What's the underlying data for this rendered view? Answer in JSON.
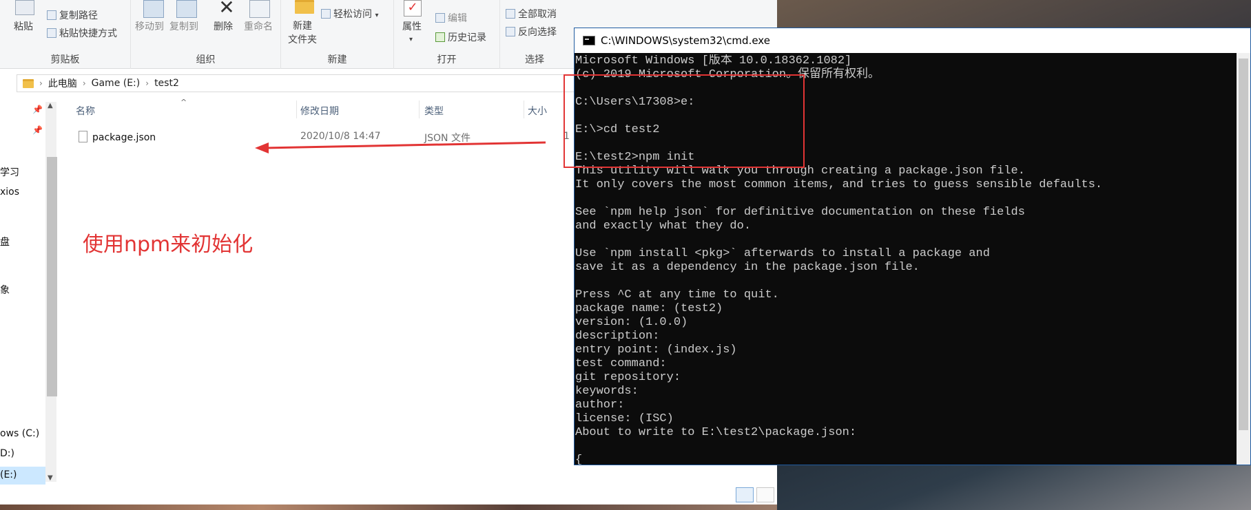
{
  "ribbon": {
    "clipboard": {
      "paste_label": "粘贴",
      "copy_path": "复制路径",
      "paste_shortcut": "粘贴快捷方式",
      "group_label": "剪贴板"
    },
    "organize": {
      "move_to": "移动到",
      "copy_to": "复制到",
      "delete": "删除",
      "rename": "重命名",
      "group_label": "组织"
    },
    "new": {
      "new_folder_line1": "新建",
      "new_folder_line2": "文件夹",
      "easy_access": "轻松访问",
      "group_label": "新建"
    },
    "open": {
      "properties": "属性",
      "edit": "编辑",
      "history": "历史记录",
      "group_label": "打开"
    },
    "select": {
      "select_none": "全部取消",
      "invert": "反向选择",
      "group_label": "选择"
    }
  },
  "address": {
    "crumbs": [
      "此电脑",
      "Game (E:)",
      "test2"
    ]
  },
  "nav": {
    "items": [
      "学习",
      "xios",
      "盘",
      "象",
      "ows (C:)",
      "D:)",
      "(E:)"
    ]
  },
  "filelist": {
    "columns": [
      "名称",
      "修改日期",
      "类型",
      "大小"
    ],
    "rows": [
      {
        "name": "package.json",
        "modified": "2020/10/8 14:47",
        "type": "JSON 文件",
        "size": "1"
      }
    ]
  },
  "annotation": {
    "text": "使用npm来初始化",
    "color": "#e23434"
  },
  "cmd": {
    "title": "C:\\WINDOWS\\system32\\cmd.exe",
    "lines": [
      "Microsoft Windows [版本 10.0.18362.1082]",
      "(c) 2019 Microsoft Corporation。保留所有权利。",
      "",
      "C:\\Users\\17308>e:",
      "",
      "E:\\>cd test2",
      "",
      "E:\\test2>npm init",
      "This utility will walk you through creating a package.json file.",
      "It only covers the most common items, and tries to guess sensible defaults.",
      "",
      "See `npm help json` for definitive documentation on these fields",
      "and exactly what they do.",
      "",
      "Use `npm install <pkg>` afterwards to install a package and",
      "save it as a dependency in the package.json file.",
      "",
      "Press ^C at any time to quit.",
      "package name: (test2)",
      "version: (1.0.0)",
      "description:",
      "entry point: (index.js)",
      "test command:",
      "git repository:",
      "keywords:",
      "author:",
      "license: (ISC)",
      "About to write to E:\\test2\\package.json:",
      "",
      "{"
    ]
  },
  "colors": {
    "accent": "#1e5aa0",
    "annotation_red": "#e23434",
    "terminal_bg": "#0c0c0c",
    "terminal_fg": "#cccccc"
  }
}
